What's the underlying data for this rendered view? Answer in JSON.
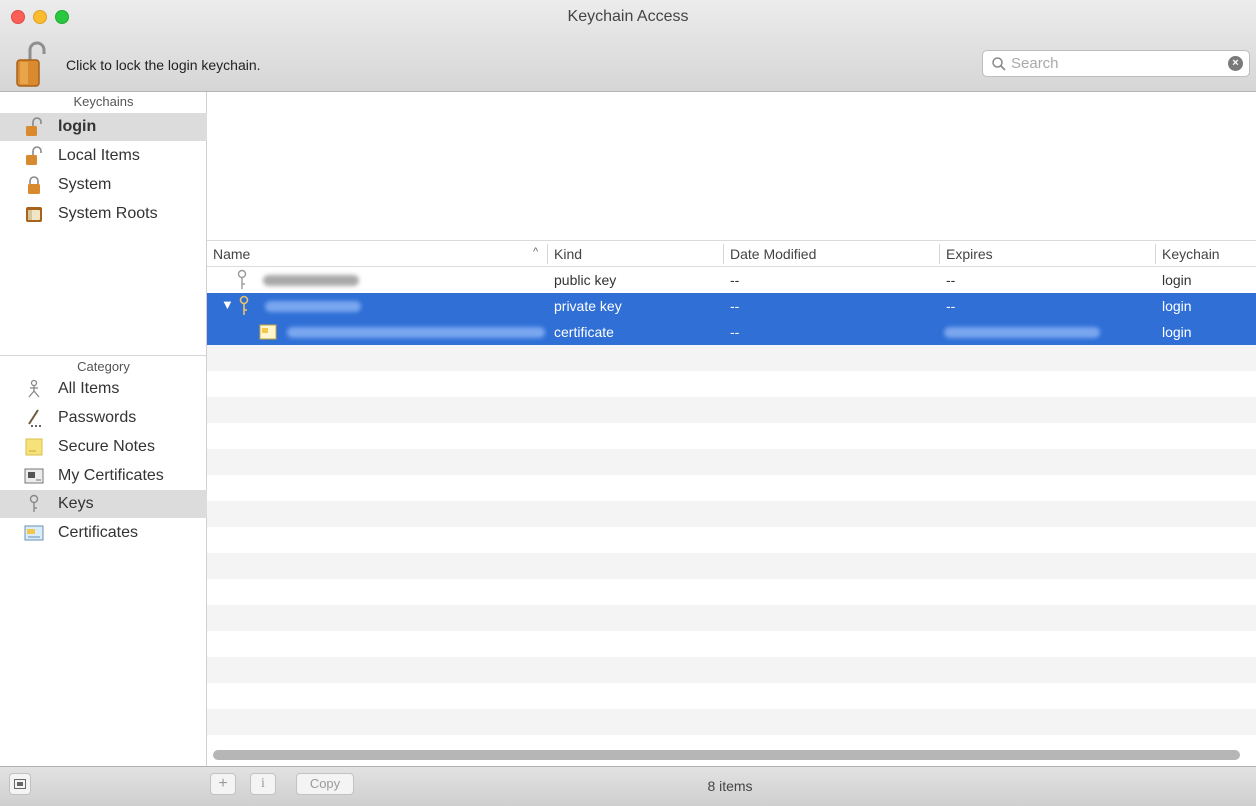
{
  "window": {
    "title": "Keychain Access"
  },
  "toolbar": {
    "lock_label": "Click to lock the login keychain.",
    "search_placeholder": "Search"
  },
  "sidebar": {
    "keychains_header": "Keychains",
    "keychains": [
      {
        "label": "login",
        "icon": "unlocked-padlock-icon",
        "selected": true
      },
      {
        "label": "Local Items",
        "icon": "unlocked-padlock-icon",
        "selected": false
      },
      {
        "label": "System",
        "icon": "locked-padlock-icon",
        "selected": false
      },
      {
        "label": "System Roots",
        "icon": "cabinet-icon",
        "selected": false
      }
    ],
    "category_header": "Category",
    "categories": [
      {
        "label": "All Items",
        "icon": "all-items-icon",
        "selected": false
      },
      {
        "label": "Passwords",
        "icon": "passwords-icon",
        "selected": false
      },
      {
        "label": "Secure Notes",
        "icon": "note-icon",
        "selected": false
      },
      {
        "label": "My Certificates",
        "icon": "certificate-card-icon",
        "selected": false
      },
      {
        "label": "Keys",
        "icon": "key-icon",
        "selected": true
      },
      {
        "label": "Certificates",
        "icon": "certificate-icon",
        "selected": false
      }
    ]
  },
  "table": {
    "columns": [
      "Name",
      "Kind",
      "Date Modified",
      "Expires",
      "Keychain"
    ],
    "sort_indicator": "^",
    "rows": [
      {
        "name": "",
        "kind": "public key",
        "date_modified": "--",
        "expires": "--",
        "keychain": "login",
        "selected": false,
        "disclosure": ""
      },
      {
        "name": "",
        "kind": "private key",
        "date_modified": "--",
        "expires": "--",
        "keychain": "login",
        "selected": true,
        "disclosure": "▼"
      },
      {
        "name": "",
        "kind": "certificate",
        "date_modified": "--",
        "expires": "",
        "keychain": "login",
        "selected": true,
        "disclosure": ""
      }
    ]
  },
  "status": {
    "item_count": "8 items"
  },
  "bottom": {
    "add_label": "+",
    "info_label": "i",
    "copy_label": "Copy"
  },
  "colors": {
    "selection": "#2f6fd6",
    "sidebar_selection": "#dcdcdc"
  }
}
